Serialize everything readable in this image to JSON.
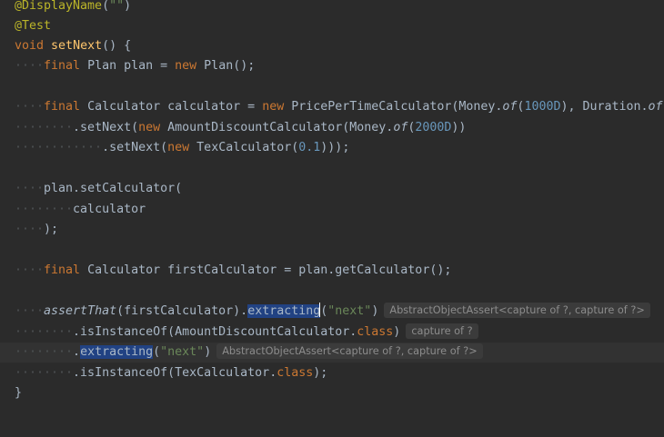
{
  "editor": {
    "line1": {
      "annotation": "@DisplayName",
      "open": "(",
      "string": "\"\"",
      "close": ")"
    },
    "line2": {
      "annotation": "@Test"
    },
    "line3": {
      "kw_void": "void",
      "method": "setNext",
      "rest": "() {"
    },
    "line4": {
      "indent": "····",
      "kw_final": "final",
      "text1": " Plan plan = ",
      "kw_new": "new",
      "text2": " Plan();"
    },
    "line6": {
      "indent": "····",
      "kw_final": "final",
      "text1": " Calculator calculator = ",
      "kw_new": "new",
      "text2": " PricePerTimeCalculator(Money.",
      "of": "of",
      "open": "(",
      "num": "1000D",
      "text3": "), Duration.",
      "of2": "of"
    },
    "line7": {
      "indent": "········",
      "text1": ".setNext(",
      "kw_new": "new",
      "text2": " AmountDiscountCalculator(Money.",
      "of": "of",
      "open": "(",
      "num": "2000D",
      "close": "))"
    },
    "line8": {
      "indent": "············",
      "text1": ".setNext(",
      "kw_new": "new",
      "text2": " TexCalculator(",
      "num": "0.1",
      "close": ")));"
    },
    "line10": {
      "indent": "····",
      "text": "plan.setCalculator("
    },
    "line11": {
      "indent": "········",
      "text": "calculator"
    },
    "line12": {
      "indent": "····",
      "text": ");"
    },
    "line14": {
      "indent": "····",
      "kw_final": "final",
      "text": " Calculator firstCalculator = plan.getCalculator();"
    },
    "line16": {
      "indent": "····",
      "assert": "assertThat",
      "text1": "(firstCalculator).",
      "extracting": "extracting",
      "open": "(",
      "string": "\"next\"",
      "close": ")",
      "hint": "AbstractObjectAssert<capture of ?, capture of ?>"
    },
    "line17": {
      "indent": "········",
      "text1": ".isInstanceOf(AmountDiscountCalculator.",
      "kw_class": "class",
      "close": ")",
      "hint": "capture of ?"
    },
    "line18": {
      "indent": "········",
      "dot": ".",
      "extracting": "extracting",
      "open": "(",
      "string": "\"next\"",
      "close": ")",
      "hint": "AbstractObjectAssert<capture of ?, capture of ?>"
    },
    "line19": {
      "indent": "········",
      "text1": ".isInstanceOf(TexCalculator.",
      "kw_class": "class",
      "close": ");"
    },
    "line20": {
      "text": "}"
    }
  }
}
